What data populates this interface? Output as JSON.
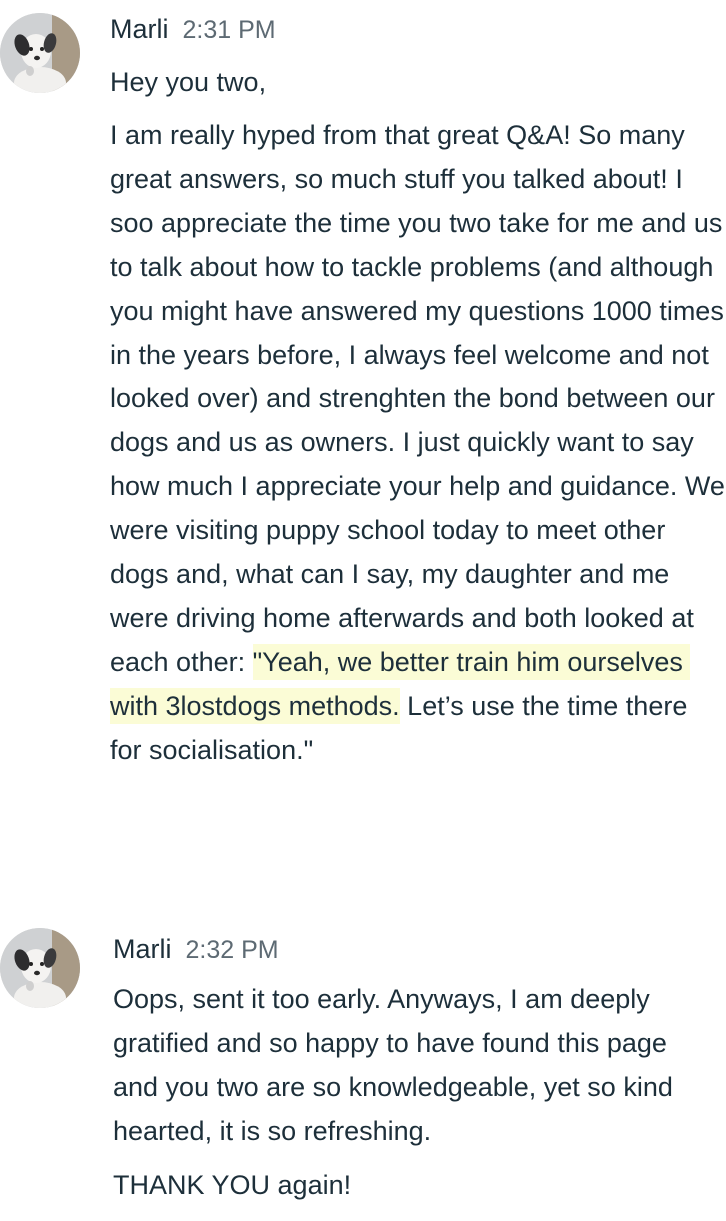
{
  "colors": {
    "text": "#1d2f3a",
    "timestamp": "#5d6a73",
    "highlight": "#fbfcd6",
    "background": "#ffffff"
  },
  "messages": [
    {
      "author": "Marli",
      "time": "2:31 PM",
      "avatar_icon": "puppy-avatar",
      "paragraphs": [
        "Hey you two,",
        "I am really hyped from that great Q&A! So many great answers, so much stuff you talked about! I soo appreciate the time you two take for me and us to talk about how to tackle problems (and although you might have answered my questions 1000 times in the years before, I always feel welcome and not looked over) and strenghten the bond between our dogs and us as owners. I just quickly want to say how much I appreciate your help and guidance. We were visiting puppy school today to meet other dogs and, what can I say, my daughter and me were driving home afterwards and both looked at each other: "
      ],
      "highlighted": "\"Yeah, we better train him ourselves with 3lostdogs methods.",
      "after_highlight": " Let’s use the time there for socialisation.\""
    },
    {
      "author": "Marli",
      "time": "2:32 PM",
      "avatar_icon": "puppy-avatar",
      "paragraphs": [
        "Oops, sent it too early. Anyways, I am deeply gratified and so happy to have found this page and you two are so knowledgeable, yet so kind hearted, it is so refreshing.",
        "THANK YOU again!"
      ]
    }
  ]
}
